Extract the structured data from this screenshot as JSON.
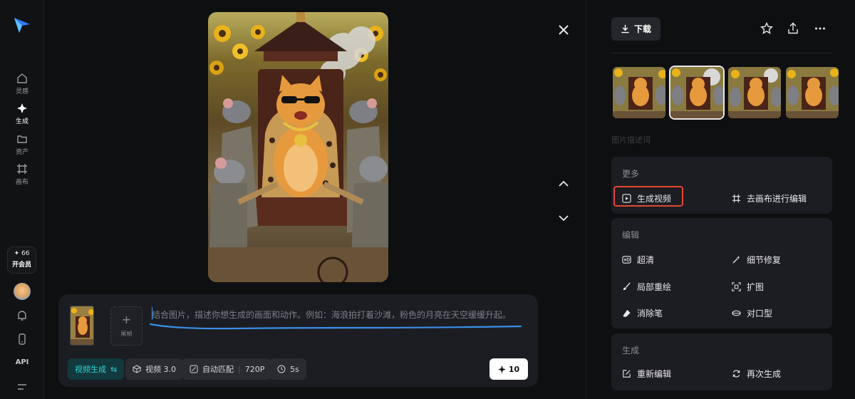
{
  "sidebar": {
    "nav": [
      {
        "label": "灵感",
        "icon": "home-icon"
      },
      {
        "label": "生成",
        "icon": "sparkle-icon"
      },
      {
        "label": "资产",
        "icon": "folder-icon"
      },
      {
        "label": "画布",
        "icon": "canvas-icon"
      }
    ],
    "credits": "✦ 66",
    "vip_label": "开会员",
    "api_label": "API"
  },
  "prompt": {
    "tail_frame_label": "尾帧",
    "placeholder": "结合图片，描述你想生成的画面和动作。例如：海浪拍打着沙滩，粉色的月亮在天空缓缓升起。",
    "mode_label": "视频生成",
    "mode_icon": "⇆",
    "model_label": "视频 3.0",
    "ratio_label": "自动匹配",
    "resolution_label": "720P",
    "duration_label": "5s",
    "generate_cost": "10"
  },
  "right_panel": {
    "download_label": "下载",
    "description_label": "图片描述词",
    "more": {
      "title": "更多",
      "actions": [
        {
          "label": "生成视频",
          "icon": "play-icon"
        },
        {
          "label": "去画布进行编辑",
          "icon": "canvas-icon"
        }
      ]
    },
    "edit": {
      "title": "编辑",
      "actions": [
        {
          "label": "超清",
          "icon": "hd-icon"
        },
        {
          "label": "细节修复",
          "icon": "magic-wand-icon"
        },
        {
          "label": "局部重绘",
          "icon": "brush-icon"
        },
        {
          "label": "扩图",
          "icon": "expand-icon"
        },
        {
          "label": "消除笔",
          "icon": "eraser-icon"
        },
        {
          "label": "对口型",
          "icon": "lips-icon"
        }
      ]
    },
    "generate": {
      "title": "生成",
      "actions": [
        {
          "label": "重新编辑",
          "icon": "re-edit-icon"
        },
        {
          "label": "再次生成",
          "icon": "regenerate-icon"
        }
      ]
    }
  },
  "colors": {
    "accent_teal": "#2fd4d4",
    "highlight_red": "#e5452f",
    "logo_blue": "#3aa0ff"
  }
}
